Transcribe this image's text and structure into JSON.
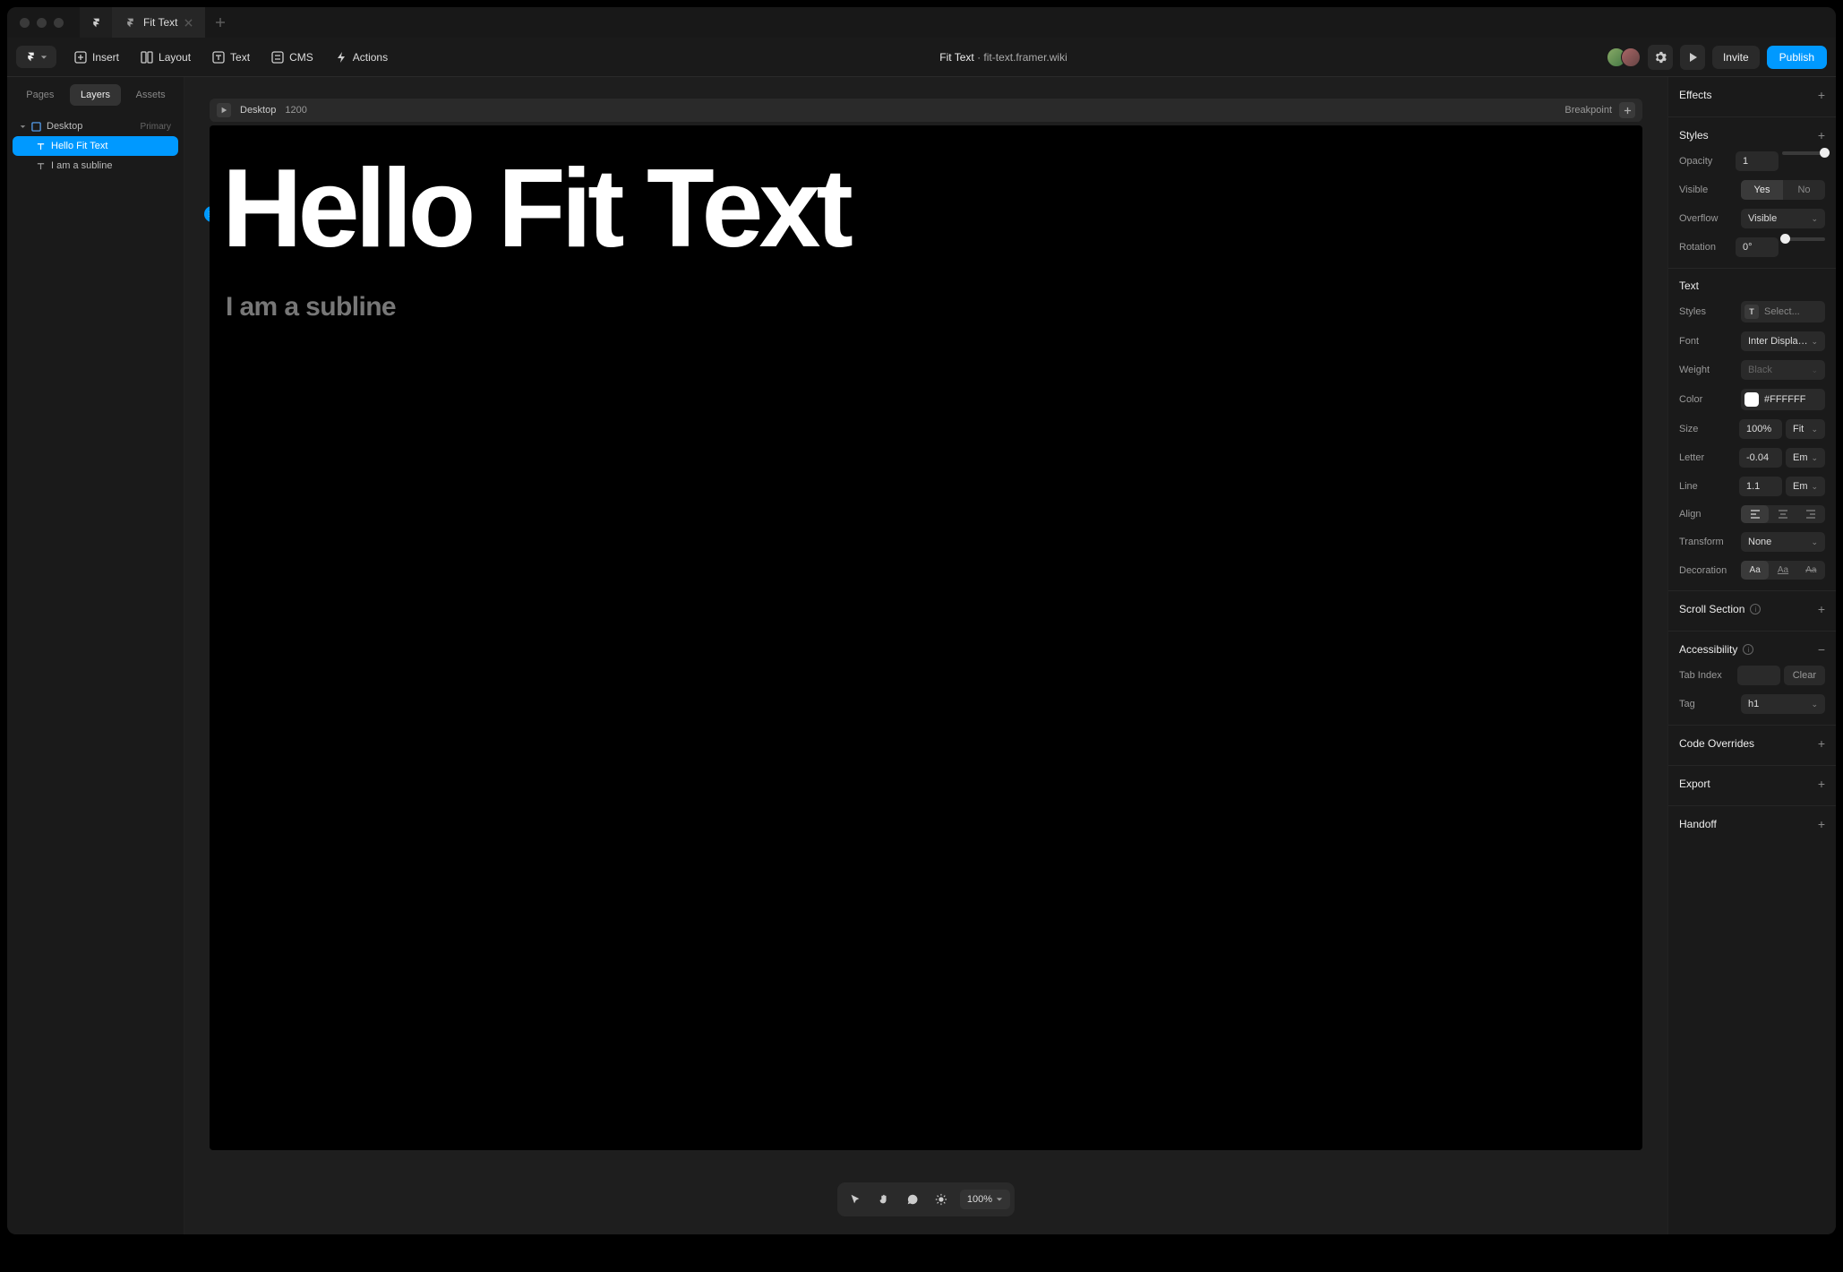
{
  "titlebar": {
    "tab_title": "Fit Text",
    "app_icon": "framer"
  },
  "toolbar": {
    "insert": "Insert",
    "layout": "Layout",
    "text": "Text",
    "cms": "CMS",
    "actions": "Actions",
    "project_name": "Fit Text",
    "project_url": "fit-text.framer.wiki",
    "invite": "Invite",
    "publish": "Publish"
  },
  "sidebar": {
    "tabs": {
      "pages": "Pages",
      "layers": "Layers",
      "assets": "Assets"
    },
    "root": {
      "label": "Desktop",
      "meta": "Primary"
    },
    "items": [
      {
        "label": "Hello Fit Text"
      },
      {
        "label": "I am a subline"
      }
    ]
  },
  "canvas": {
    "frame_label": "Desktop",
    "frame_width": "1200",
    "breakpoint_label": "Breakpoint",
    "hero_text": "Hello Fit Text",
    "subline_text": "I am a subline"
  },
  "bottom_toolbar": {
    "zoom": "100%"
  },
  "panel": {
    "effects": "Effects",
    "styles_header": "Styles",
    "opacity_label": "Opacity",
    "opacity_value": "1",
    "visible_label": "Visible",
    "visible_yes": "Yes",
    "visible_no": "No",
    "overflow_label": "Overflow",
    "overflow_value": "Visible",
    "rotation_label": "Rotation",
    "rotation_value": "0°",
    "text_header": "Text",
    "text_styles_label": "Styles",
    "text_styles_value": "Select...",
    "font_label": "Font",
    "font_value": "Inter Display Black",
    "weight_label": "Weight",
    "weight_value": "Black",
    "color_label": "Color",
    "color_value": "#FFFFFF",
    "size_label": "Size",
    "size_value": "100%",
    "size_mode": "Fit",
    "letter_label": "Letter",
    "letter_value": "-0.04",
    "letter_unit": "Em",
    "line_label": "Line",
    "line_value": "1.1",
    "line_unit": "Em",
    "align_label": "Align",
    "transform_label": "Transform",
    "transform_value": "None",
    "decoration_label": "Decoration",
    "deco_none": "Aa",
    "deco_underline": "Aa",
    "deco_strike": "Aa",
    "scroll_section": "Scroll Section",
    "accessibility": "Accessibility",
    "tab_index_label": "Tab Index",
    "tab_index_clear": "Clear",
    "tag_label": "Tag",
    "tag_value": "h1",
    "code_overrides": "Code Overrides",
    "export": "Export",
    "handoff": "Handoff"
  }
}
